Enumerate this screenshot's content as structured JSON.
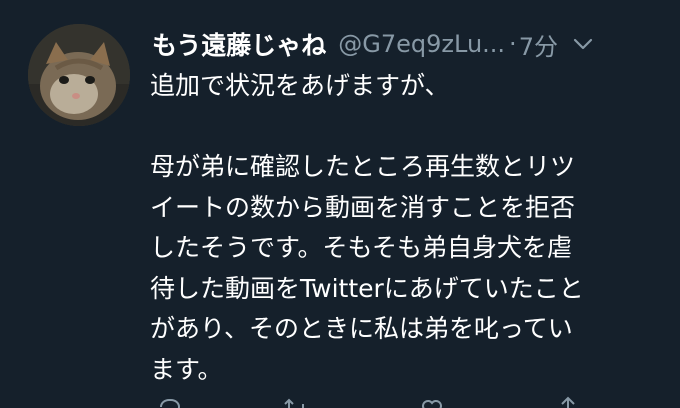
{
  "tweet": {
    "display_name": "もう遠藤じゃね",
    "handle": "@G7eq9zLu...",
    "separator": "·",
    "time": "7分",
    "lines": [
      "追加で状況をあげますが、",
      "",
      "母が弟に確認したところ再生数とリツ",
      "イートの数から動画を消すことを拒否",
      "したそうです。そもそも弟自身犬を虐",
      "待した動画をTwitterにあげていたこと",
      "があり、そのときに私は弟を叱ってい",
      "ます。"
    ]
  },
  "icons": {
    "caret": "chevron-down-icon",
    "reply": "reply-icon",
    "retweet": "retweet-icon",
    "like": "heart-icon",
    "share": "share-icon"
  },
  "colors": {
    "background": "#15202b",
    "text": "#ffffff",
    "secondary": "#8899a6"
  }
}
